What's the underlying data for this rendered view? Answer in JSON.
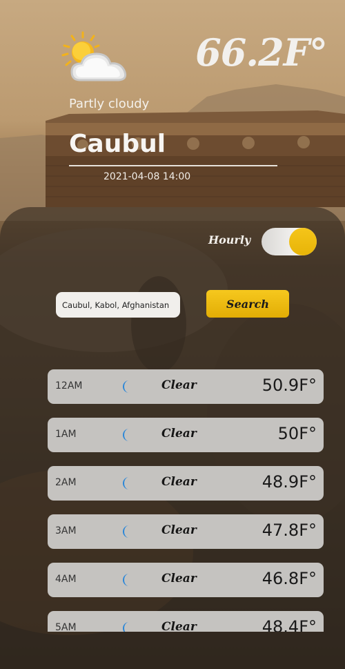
{
  "current": {
    "temperature": "66.2F°",
    "condition": "Partly cloudy",
    "city": "Caubul",
    "datetime": "2021-04-08 14:00",
    "icon": "partly-cloudy-icon"
  },
  "mode": {
    "label": "Hourly",
    "toggle_on": true
  },
  "search": {
    "value": "Caubul, Kabol, Afghanistan",
    "button_label": "Search"
  },
  "hourly": [
    {
      "time": "12AM",
      "icon": "moon-icon",
      "condition": "Clear",
      "temp": "50.9F°"
    },
    {
      "time": "1AM",
      "icon": "moon-icon",
      "condition": "Clear",
      "temp": "50F°"
    },
    {
      "time": "2AM",
      "icon": "moon-icon",
      "condition": "Clear",
      "temp": "48.9F°"
    },
    {
      "time": "3AM",
      "icon": "moon-icon",
      "condition": "Clear",
      "temp": "47.8F°"
    },
    {
      "time": "4AM",
      "icon": "moon-icon",
      "condition": "Clear",
      "temp": "46.8F°"
    },
    {
      "time": "5AM",
      "icon": "moon-icon",
      "condition": "Clear",
      "temp": "48.4F°"
    }
  ],
  "colors": {
    "accent": "#f2c200",
    "row_bg": "#c5c3c0",
    "moon": "#2a86d8"
  }
}
